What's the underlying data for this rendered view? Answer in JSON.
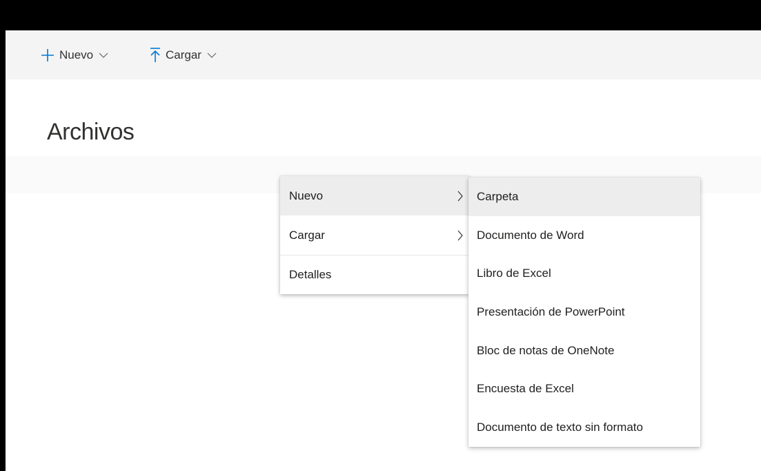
{
  "toolbar": {
    "new_label": "Nuevo",
    "upload_label": "Cargar"
  },
  "page": {
    "title": "Archivos"
  },
  "context_menu": {
    "items": [
      {
        "label": "Nuevo",
        "has_submenu": true,
        "selected": true
      },
      {
        "label": "Cargar",
        "has_submenu": true,
        "selected": false
      },
      {
        "label": "Detalles",
        "has_submenu": false,
        "selected": false
      }
    ]
  },
  "submenu": {
    "items": [
      {
        "label": "Carpeta"
      },
      {
        "label": "Documento de Word"
      },
      {
        "label": "Libro de Excel"
      },
      {
        "label": "Presentación de PowerPoint"
      },
      {
        "label": "Bloc de notas de OneNote"
      },
      {
        "label": "Encuesta de Excel"
      },
      {
        "label": "Documento de texto sin formato"
      }
    ]
  },
  "colors": {
    "accent": "#0078d4",
    "text": "#323130",
    "selected_bg": "#ededed"
  },
  "icons": {
    "new": "plus-icon",
    "upload": "upload-arrow-icon",
    "dropdown": "chevron-down-icon",
    "submenu": "chevron-right-icon"
  }
}
